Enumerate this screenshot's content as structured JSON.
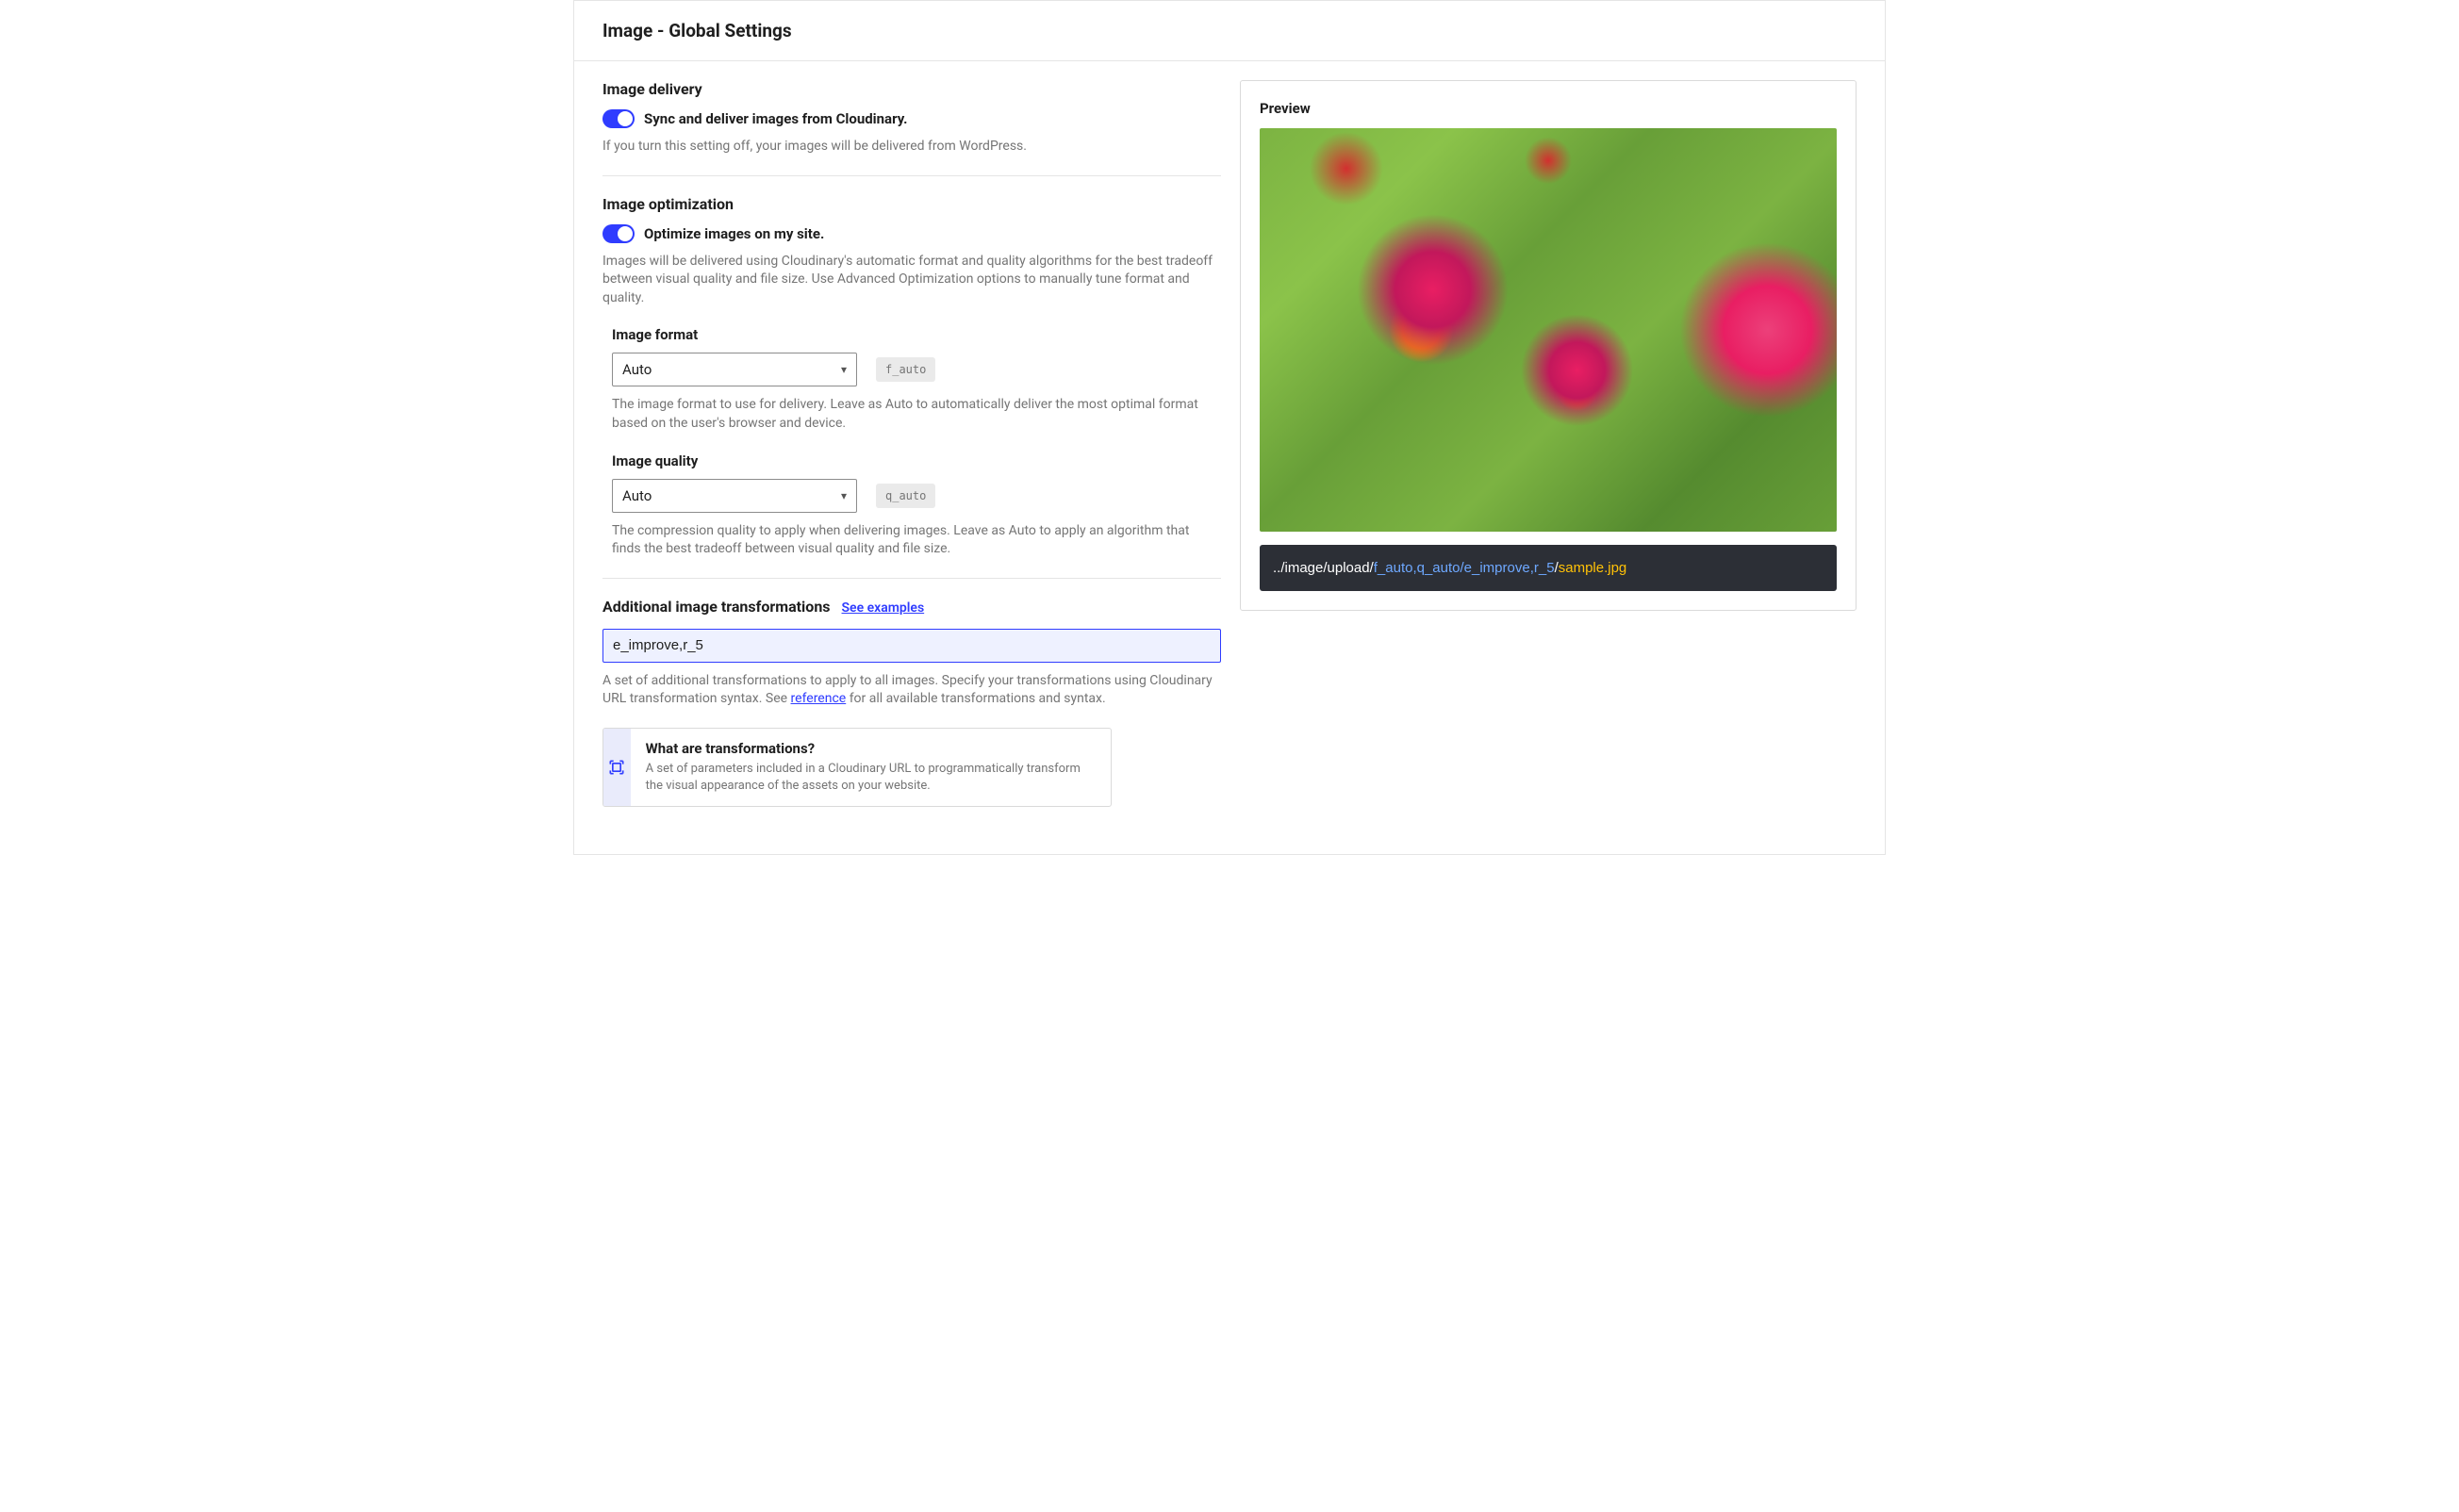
{
  "page": {
    "title": "Image - Global Settings"
  },
  "delivery": {
    "heading": "Image delivery",
    "toggle_label": "Sync and deliver images from Cloudinary.",
    "help": "If you turn this setting off, your images will be delivered from WordPress."
  },
  "optimization": {
    "heading": "Image optimization",
    "toggle_label": "Optimize images on my site.",
    "help": "Images will be delivered using Cloudinary's automatic format and quality algorithms for the best tradeoff between visual quality and file size. Use Advanced Optimization options to manually tune format and quality.",
    "format": {
      "label": "Image format",
      "value": "Auto",
      "badge": "f_auto",
      "help": "The image format to use for delivery. Leave as Auto to automatically deliver the most optimal format based on the user's browser and device."
    },
    "quality": {
      "label": "Image quality",
      "value": "Auto",
      "badge": "q_auto",
      "help": "The compression quality to apply when delivering images. Leave as Auto to apply an algorithm that finds the best tradeoff between visual quality and file size."
    }
  },
  "transformations": {
    "heading": "Additional image transformations",
    "see_examples": "See examples",
    "value": "e_improve,r_5",
    "help_pre": "A set of additional transformations to apply to all images. Specify your transformations using Cloudinary URL transformation syntax. See ",
    "reference_link": "reference",
    "help_post": " for all available transformations and syntax.",
    "info": {
      "title": "What are transformations?",
      "desc": "A set of parameters included in a Cloudinary URL to programmatically transform the visual appearance of the assets on your website."
    }
  },
  "preview": {
    "label": "Preview",
    "url": {
      "base": "../image/upload",
      "sep1": "/",
      "transform": "f_auto,q_auto/e_improve,r_5",
      "sep2": "/",
      "file": "sample.jpg"
    }
  }
}
